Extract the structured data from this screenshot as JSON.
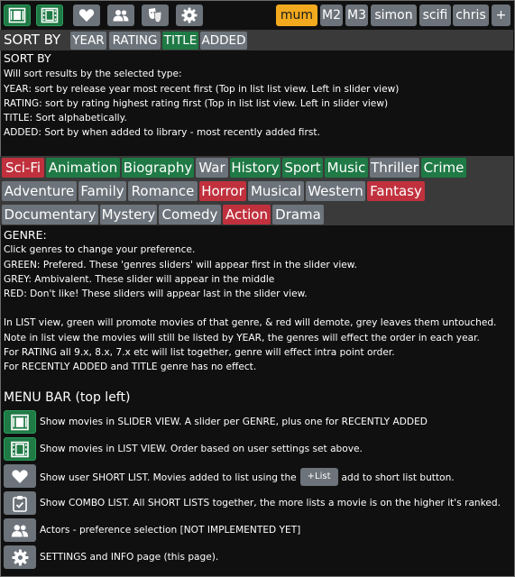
{
  "menu": {
    "icons": [
      {
        "name": "slider-view-icon",
        "style": "green"
      },
      {
        "name": "list-view-icon",
        "style": "green"
      },
      {
        "name": "heart-icon",
        "style": "grey"
      },
      {
        "name": "users-icon",
        "style": "grey"
      },
      {
        "name": "masks-icon",
        "style": "grey"
      },
      {
        "name": "gear-icon",
        "style": "grey"
      }
    ],
    "users": [
      "mum",
      "M2",
      "M3",
      "simon",
      "scifi",
      "chris",
      "+"
    ],
    "selected_user": "mum"
  },
  "sort": {
    "label": "SORT BY",
    "options": [
      "YEAR",
      "RATING",
      "TITLE",
      "ADDED"
    ],
    "selected": "TITLE",
    "help_title": "SORT BY",
    "help": [
      "Will sort results by the selected type:",
      "YEAR: sort by release year most recent first (Top in list list view. Left in slider view)",
      "RATING: sort by rating highest rating first (Top in list list view. Left in slider view)",
      "TITLE: Sort alphabetically.",
      "ADDED: Sort by when added to library - most recently added first."
    ]
  },
  "genres": {
    "rows": [
      [
        {
          "label": "Sci-Fi",
          "state": "red"
        },
        {
          "label": "Animation",
          "state": "green"
        },
        {
          "label": "Biography",
          "state": "green"
        },
        {
          "label": "War",
          "state": "grey"
        },
        {
          "label": "History",
          "state": "green"
        },
        {
          "label": "Sport",
          "state": "green"
        },
        {
          "label": "Music",
          "state": "green"
        },
        {
          "label": "Thriller",
          "state": "grey"
        },
        {
          "label": "Crime",
          "state": "green"
        }
      ],
      [
        {
          "label": "Adventure",
          "state": "grey"
        },
        {
          "label": "Family",
          "state": "grey"
        },
        {
          "label": "Romance",
          "state": "grey"
        },
        {
          "label": "Horror",
          "state": "red"
        },
        {
          "label": "Musical",
          "state": "grey"
        },
        {
          "label": "Western",
          "state": "grey"
        },
        {
          "label": "Fantasy",
          "state": "red"
        }
      ],
      [
        {
          "label": "Documentary",
          "state": "grey"
        },
        {
          "label": "Mystery",
          "state": "grey"
        },
        {
          "label": "Comedy",
          "state": "grey"
        },
        {
          "label": "Action",
          "state": "red"
        },
        {
          "label": "Drama",
          "state": "grey"
        }
      ]
    ],
    "help_title": "GENRE:",
    "help": [
      "Click genres to change your preference.",
      "GREEN: Prefered. These 'genres sliders' will appear first in the slider view.",
      "GREY: Ambivalent. These slider will appear in the middle",
      "RED: Don't like! These sliders will appear last in the slider view.",
      "",
      "In LIST view, green will promote movies of that genre, & red will demote, grey leaves them untouched.",
      "Note in list view the movies will still be listed by YEAR, the genres will effect the order in each year.",
      "For RATING all 9.x, 8.x, 7.x etc will list together, genre will effect intra point order.",
      "For RECENTLY ADDED and TITLE genre has no effect."
    ]
  },
  "menubar_help": {
    "title": "MENU BAR (top left)",
    "items": [
      {
        "icon": "slider-view-icon",
        "text": "Show movies in SLIDER VIEW. A slider per GENRE, plus one for RECENTLY ADDED"
      },
      {
        "icon": "list-view-icon",
        "text": "Show movies in LIST VIEW. Order based on user settings set above."
      },
      {
        "icon": "heart-icon",
        "text_before": "Show user SHORT LIST. Movies added to list using the",
        "button": "+List",
        "text_after": "add to short list button."
      },
      {
        "icon": "clipboard-icon",
        "text": "Show COMBO LIST. All SHORT LISTS together, the more lists a movie is on the higher it's ranked."
      },
      {
        "icon": "users-icon",
        "text": "Actors - preference selection [NOT IMPLEMENTED YET]"
      },
      {
        "icon": "gear-icon",
        "text": "SETTINGS and INFO page (this page)."
      }
    ]
  }
}
